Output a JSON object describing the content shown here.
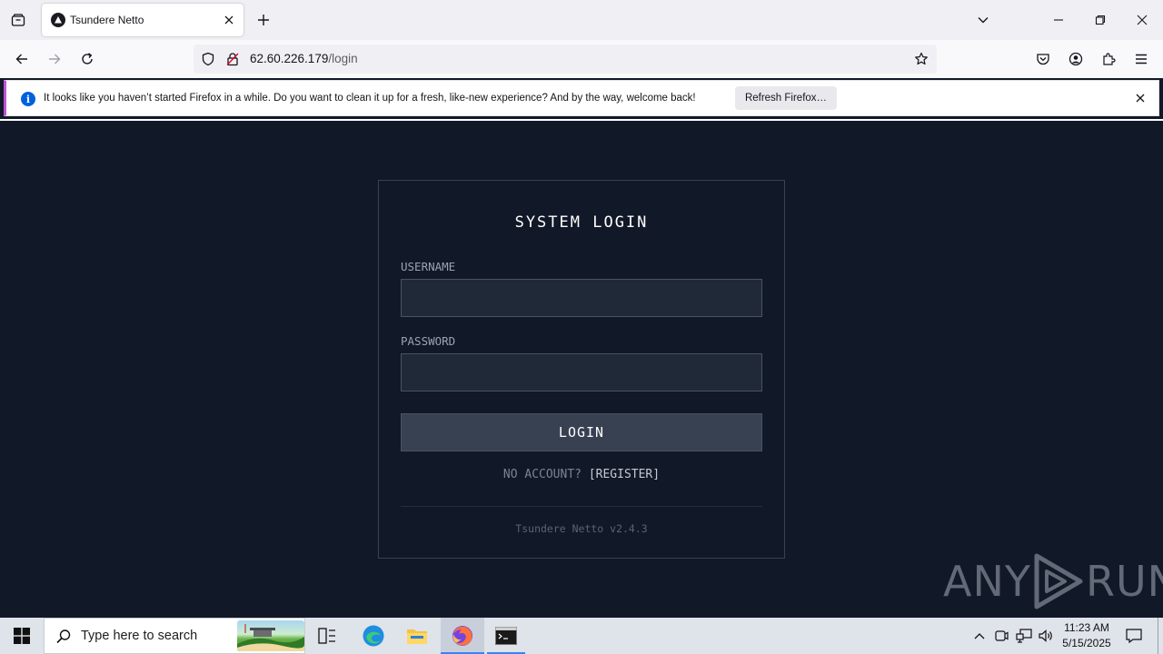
{
  "browser": {
    "tab": {
      "title": "Tsundere Netto"
    },
    "url": {
      "host": "62.60.226.179",
      "path": "/login"
    },
    "notification": {
      "message": "It looks like you haven’t started Firefox in a while. Do you want to clean it up for a fresh, like-new experience? And by the way, welcome back!",
      "button_label": "Refresh Firefox…"
    }
  },
  "login": {
    "title": "SYSTEM LOGIN",
    "username_label": "USERNAME",
    "username_value": "",
    "password_label": "PASSWORD",
    "password_value": "",
    "button_label": "LOGIN",
    "no_account_text": "NO ACCOUNT?",
    "register_label": "[REGISTER]",
    "version": "Tsundere Netto v2.4.3"
  },
  "watermark": {
    "left": "ANY",
    "right": "RUN"
  },
  "taskbar": {
    "search_placeholder": "Type here to search",
    "time": "11:23 AM",
    "date": "5/15/2025"
  },
  "colors": {
    "page_bg": "#111827",
    "input_bg": "#1f2937",
    "button_bg": "#374151",
    "notification_accent": "#c04fd8",
    "info_icon": "#0060df"
  }
}
